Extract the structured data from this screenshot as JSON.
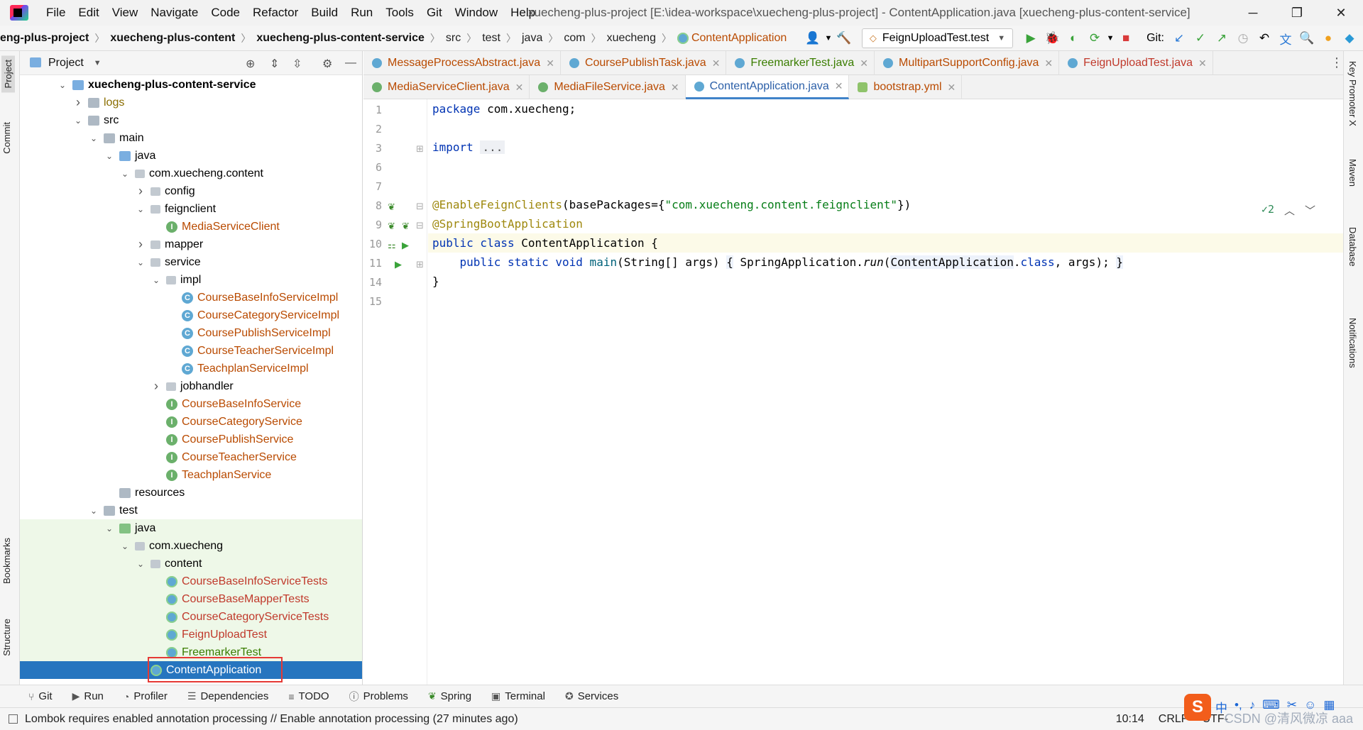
{
  "window": {
    "title": "xuecheng-plus-project [E:\\idea-workspace\\xuecheng-plus-project] - ContentApplication.java [xuecheng-plus-content-service]",
    "menu": [
      "File",
      "Edit",
      "View",
      "Navigate",
      "Code",
      "Refactor",
      "Build",
      "Run",
      "Tools",
      "Git",
      "Window",
      "Help"
    ],
    "controls": {
      "minimize": "─",
      "restore": "❐",
      "close": "✕"
    }
  },
  "breadcrumb": {
    "items": [
      "eng-plus-project",
      "xuecheng-plus-content",
      "xuecheng-plus-content-service",
      "src",
      "test",
      "java",
      "com",
      "xuecheng",
      "ContentApplication"
    ]
  },
  "toolbar": {
    "run_config": "FeignUploadTest.test",
    "git_label": "Git:"
  },
  "project_panel": {
    "title": "Project",
    "tree": [
      {
        "label": "xuecheng-plus-content-service",
        "depth": 0,
        "chev": "v",
        "icon": "module",
        "color": "bold"
      },
      {
        "label": "logs",
        "depth": 1,
        "chev": ">",
        "icon": "folder",
        "color": "olive"
      },
      {
        "label": "src",
        "depth": 1,
        "chev": "v",
        "icon": "folder",
        "color": ""
      },
      {
        "label": "main",
        "depth": 2,
        "chev": "v",
        "icon": "folder",
        "color": ""
      },
      {
        "label": "java",
        "depth": 3,
        "chev": "v",
        "icon": "folder-blue",
        "color": ""
      },
      {
        "label": "com.xuecheng.content",
        "depth": 4,
        "chev": "v",
        "icon": "package",
        "color": ""
      },
      {
        "label": "config",
        "depth": 5,
        "chev": ">",
        "icon": "package",
        "color": ""
      },
      {
        "label": "feignclient",
        "depth": 5,
        "chev": "v",
        "icon": "package",
        "color": ""
      },
      {
        "label": "MediaServiceClient",
        "depth": 6,
        "chev": "",
        "icon": "interface",
        "color": "orange"
      },
      {
        "label": "mapper",
        "depth": 5,
        "chev": ">",
        "icon": "package",
        "color": ""
      },
      {
        "label": "service",
        "depth": 5,
        "chev": "v",
        "icon": "package",
        "color": ""
      },
      {
        "label": "impl",
        "depth": 6,
        "chev": "v",
        "icon": "package",
        "color": ""
      },
      {
        "label": "CourseBaseInfoServiceImpl",
        "depth": 7,
        "chev": "",
        "icon": "class",
        "color": "orange"
      },
      {
        "label": "CourseCategoryServiceImpl",
        "depth": 7,
        "chev": "",
        "icon": "class",
        "color": "orange"
      },
      {
        "label": "CoursePublishServiceImpl",
        "depth": 7,
        "chev": "",
        "icon": "class",
        "color": "orange"
      },
      {
        "label": "CourseTeacherServiceImpl",
        "depth": 7,
        "chev": "",
        "icon": "class",
        "color": "orange"
      },
      {
        "label": "TeachplanServiceImpl",
        "depth": 7,
        "chev": "",
        "icon": "class",
        "color": "orange"
      },
      {
        "label": "jobhandler",
        "depth": 6,
        "chev": ">",
        "icon": "package",
        "color": ""
      },
      {
        "label": "CourseBaseInfoService",
        "depth": 6,
        "chev": "",
        "icon": "interface",
        "color": "orange"
      },
      {
        "label": "CourseCategoryService",
        "depth": 6,
        "chev": "",
        "icon": "interface",
        "color": "orange"
      },
      {
        "label": "CoursePublishService",
        "depth": 6,
        "chev": "",
        "icon": "interface",
        "color": "orange"
      },
      {
        "label": "CourseTeacherService",
        "depth": 6,
        "chev": "",
        "icon": "interface",
        "color": "orange"
      },
      {
        "label": "TeachplanService",
        "depth": 6,
        "chev": "",
        "icon": "interface",
        "color": "orange"
      },
      {
        "label": "resources",
        "depth": 3,
        "chev": "",
        "icon": "folder",
        "color": ""
      },
      {
        "label": "test",
        "depth": 2,
        "chev": "v",
        "icon": "folder",
        "color": ""
      },
      {
        "label": "java",
        "depth": 3,
        "chev": "v",
        "icon": "folder-green",
        "color": "",
        "green": true
      },
      {
        "label": "com.xuecheng",
        "depth": 4,
        "chev": "v",
        "icon": "package",
        "color": "",
        "green": true
      },
      {
        "label": "content",
        "depth": 5,
        "chev": "v",
        "icon": "package",
        "color": "",
        "green": true
      },
      {
        "label": "CourseBaseInfoServiceTests",
        "depth": 6,
        "chev": "",
        "icon": "springtest",
        "color": "red",
        "green": true
      },
      {
        "label": "CourseBaseMapperTests",
        "depth": 6,
        "chev": "",
        "icon": "springtest",
        "color": "red",
        "green": true
      },
      {
        "label": "CourseCategoryServiceTests",
        "depth": 6,
        "chev": "",
        "icon": "springtest",
        "color": "red",
        "green": true
      },
      {
        "label": "FeignUploadTest",
        "depth": 6,
        "chev": "",
        "icon": "springtest",
        "color": "red",
        "green": true
      },
      {
        "label": "FreemarkerTest",
        "depth": 6,
        "chev": "",
        "icon": "springtest",
        "color": "green",
        "green": true
      },
      {
        "label": "ContentApplication",
        "depth": 5,
        "chev": "",
        "icon": "springboot",
        "color": "",
        "selected": true
      }
    ]
  },
  "tabs_row1": [
    {
      "label": "MessageProcessAbstract.java",
      "icon": "c",
      "color": "orange"
    },
    {
      "label": "CoursePublishTask.java",
      "icon": "c",
      "color": "orange"
    },
    {
      "label": "FreemarkerTest.java",
      "icon": "c",
      "color": "green"
    },
    {
      "label": "MultipartSupportConfig.java",
      "icon": "c",
      "color": "orange"
    },
    {
      "label": "FeignUploadTest.java",
      "icon": "c",
      "color": "red"
    }
  ],
  "tabs_row2": [
    {
      "label": "MediaServiceClient.java",
      "icon": "i",
      "color": "orange"
    },
    {
      "label": "MediaFileService.java",
      "icon": "i",
      "color": "orange"
    },
    {
      "label": "ContentApplication.java",
      "icon": "c",
      "color": "blue",
      "active": true
    },
    {
      "label": "bootstrap.yml",
      "icon": "y",
      "color": "orange"
    }
  ],
  "editor": {
    "line_numbers": [
      "1",
      "2",
      "3",
      "6",
      "7",
      "8",
      "9",
      "10",
      "11",
      "14",
      "15"
    ],
    "code": {
      "l1_kw": "package",
      "l1_rest": " com.xuecheng;",
      "l3_kw": "import",
      "l3_fold": "...",
      "l8_ann": "@EnableFeignClients",
      "l8_mid": "(basePackages={",
      "l8_str": "\"com.xuecheng.content.feignclient\"",
      "l8_end": "})",
      "l9_ann": "@SpringBootApplication",
      "l10_kw": "public class",
      "l10_cls": " ContentApplication",
      "l10_end": " {",
      "l11_kw": "public static void",
      "l11_m": " main",
      "l11_args": "(String[] args) ",
      "l11_b1": "{",
      "l11_call": " SpringApplication.",
      "l11_run": "run",
      "l11_p1": "(",
      "l11_cls": "ContentApplication",
      "l11_dot": ".",
      "l11_classkw": "class",
      "l11_p2": ", args); ",
      "l11_b2": "}",
      "l14": "}"
    },
    "inspection_count": "2"
  },
  "left_stripe": [
    "Project",
    "Commit",
    "Bookmarks",
    "Structure"
  ],
  "right_stripe": [
    "Key Promoter X",
    "Maven",
    "Database",
    "Notifications"
  ],
  "bottom_tools": [
    "Git",
    "Run",
    "Profiler",
    "Dependencies",
    "TODO",
    "Problems",
    "Spring",
    "Terminal",
    "Services"
  ],
  "status": {
    "message": "Lombok requires enabled annotation processing // Enable annotation processing (27 minutes ago)",
    "position": "10:14",
    "line_sep": "CRLF",
    "encoding": "UTF-",
    "watermark": "CSDN @清风微凉 aaa",
    "ime": "中"
  }
}
